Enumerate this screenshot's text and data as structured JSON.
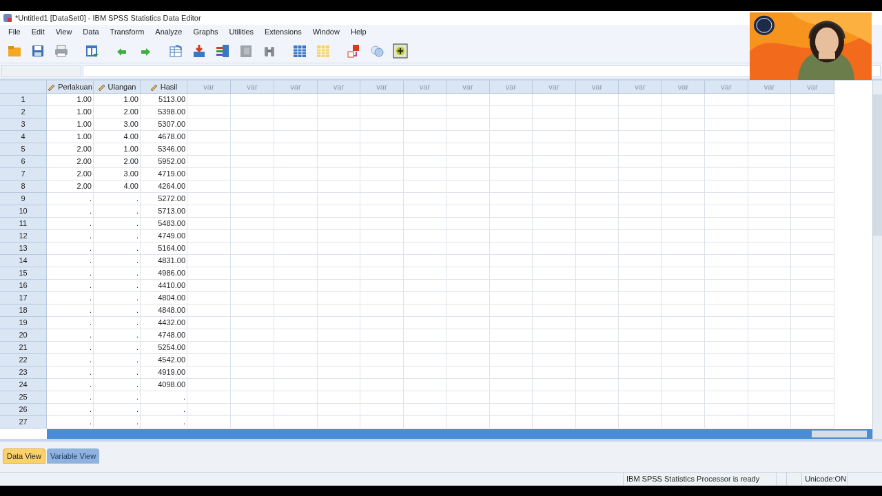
{
  "window": {
    "title": "*Untitled1 [DataSet0] - IBM SPSS Statistics Data Editor"
  },
  "menu": [
    "File",
    "Edit",
    "View",
    "Data",
    "Transform",
    "Analyze",
    "Graphs",
    "Utilities",
    "Extensions",
    "Window",
    "Help"
  ],
  "grid": {
    "columns": [
      {
        "name": "Perlakuan",
        "kind": "variable"
      },
      {
        "name": "Ulangan",
        "kind": "variable"
      },
      {
        "name": "Hasil",
        "kind": "variable"
      },
      {
        "name": "var",
        "kind": "empty"
      },
      {
        "name": "var",
        "kind": "empty"
      },
      {
        "name": "var",
        "kind": "empty"
      },
      {
        "name": "var",
        "kind": "empty"
      },
      {
        "name": "var",
        "kind": "empty"
      },
      {
        "name": "var",
        "kind": "empty"
      },
      {
        "name": "var",
        "kind": "empty"
      },
      {
        "name": "var",
        "kind": "empty"
      },
      {
        "name": "var",
        "kind": "empty"
      },
      {
        "name": "var",
        "kind": "empty"
      },
      {
        "name": "var",
        "kind": "empty"
      },
      {
        "name": "var",
        "kind": "empty"
      },
      {
        "name": "var",
        "kind": "empty"
      },
      {
        "name": "var",
        "kind": "empty"
      },
      {
        "name": "var",
        "kind": "empty"
      }
    ],
    "rows": [
      {
        "number": "1",
        "cells": [
          "1.00",
          "1.00",
          "5113.00"
        ]
      },
      {
        "number": "2",
        "cells": [
          "1.00",
          "2.00",
          "5398.00"
        ]
      },
      {
        "number": "3",
        "cells": [
          "1.00",
          "3.00",
          "5307.00"
        ]
      },
      {
        "number": "4",
        "cells": [
          "1.00",
          "4.00",
          "4678.00"
        ]
      },
      {
        "number": "5",
        "cells": [
          "2.00",
          "1.00",
          "5346.00"
        ]
      },
      {
        "number": "6",
        "cells": [
          "2.00",
          "2.00",
          "5952.00"
        ]
      },
      {
        "number": "7",
        "cells": [
          "2.00",
          "3.00",
          "4719.00"
        ]
      },
      {
        "number": "8",
        "cells": [
          "2.00",
          "4.00",
          "4264.00"
        ]
      },
      {
        "number": "9",
        "cells": [
          ".",
          ".",
          "5272.00"
        ]
      },
      {
        "number": "10",
        "cells": [
          ".",
          ".",
          "5713.00"
        ]
      },
      {
        "number": "11",
        "cells": [
          ".",
          ".",
          "5483.00"
        ]
      },
      {
        "number": "12",
        "cells": [
          ".",
          ".",
          "4749.00"
        ]
      },
      {
        "number": "13",
        "cells": [
          ".",
          ".",
          "5164.00"
        ]
      },
      {
        "number": "14",
        "cells": [
          ".",
          ".",
          "4831.00"
        ]
      },
      {
        "number": "15",
        "cells": [
          ".",
          ".",
          "4986.00"
        ]
      },
      {
        "number": "16",
        "cells": [
          ".",
          ".",
          "4410.00"
        ]
      },
      {
        "number": "17",
        "cells": [
          ".",
          ".",
          "4804.00"
        ]
      },
      {
        "number": "18",
        "cells": [
          ".",
          ".",
          "4848.00"
        ]
      },
      {
        "number": "19",
        "cells": [
          ".",
          ".",
          "4432.00"
        ]
      },
      {
        "number": "20",
        "cells": [
          ".",
          ".",
          "4748.00"
        ]
      },
      {
        "number": "21",
        "cells": [
          ".",
          ".",
          "5254.00"
        ]
      },
      {
        "number": "22",
        "cells": [
          ".",
          ".",
          "4542.00"
        ]
      },
      {
        "number": "23",
        "cells": [
          ".",
          ".",
          "4919.00"
        ]
      },
      {
        "number": "24",
        "cells": [
          ".",
          ".",
          "4098.00"
        ]
      },
      {
        "number": "25",
        "cells": [
          ".",
          ".",
          "."
        ]
      },
      {
        "number": "26",
        "cells": [
          ".",
          ".",
          "."
        ]
      },
      {
        "number": "27",
        "cells": [
          ".",
          ".",
          "."
        ]
      }
    ]
  },
  "tabs": [
    {
      "label": "Data View",
      "selected": true
    },
    {
      "label": "Variable View",
      "selected": false
    }
  ],
  "status_bar": [
    "IBM SPSS Statistics Processor is ready",
    "Unicode:ON"
  ],
  "webcam": {
    "kind": "picture"
  }
}
